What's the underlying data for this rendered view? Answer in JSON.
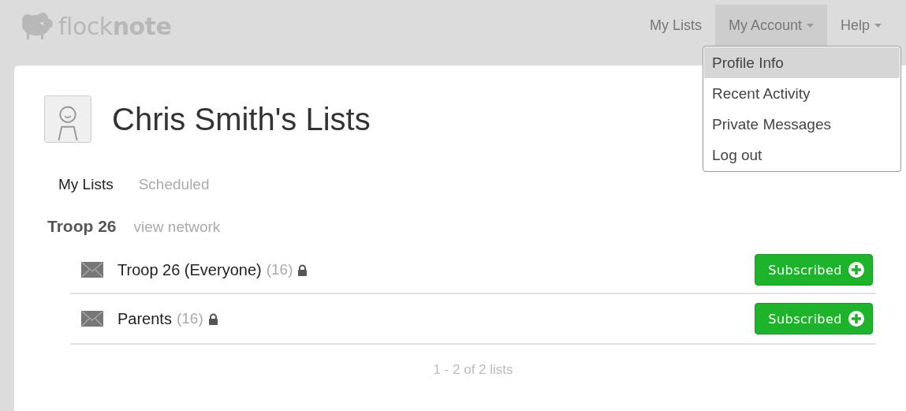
{
  "logo": {
    "text": "flock**note**"
  },
  "nav": [
    {
      "label": "My Lists",
      "open": false,
      "caret": false
    },
    {
      "label": "My Account",
      "open": true,
      "caret": true
    },
    {
      "label": "Help",
      "open": false,
      "caret": true
    }
  ],
  "dropdown": [
    {
      "label": "Profile Info",
      "selected": true
    },
    {
      "label": "Recent Activity",
      "selected": false
    },
    {
      "label": "Private Messages",
      "selected": false
    },
    {
      "label": "Log out",
      "selected": false
    }
  ],
  "page_title": "Chris Smith's Lists",
  "tabs": [
    {
      "label": "My Lists",
      "selected": true
    },
    {
      "label": "Scheduled",
      "selected": false
    }
  ],
  "network": {
    "name": "Troop 26",
    "link": "view network"
  },
  "lists": [
    {
      "name": "Troop 26 (Everyone)",
      "count": "(16)",
      "locked": true,
      "button": "Subscribed"
    },
    {
      "name": "Parents",
      "count": "(16)",
      "locked": true,
      "button": "Subscribed"
    }
  ],
  "pagination": "1 - 2 of 2 lists"
}
